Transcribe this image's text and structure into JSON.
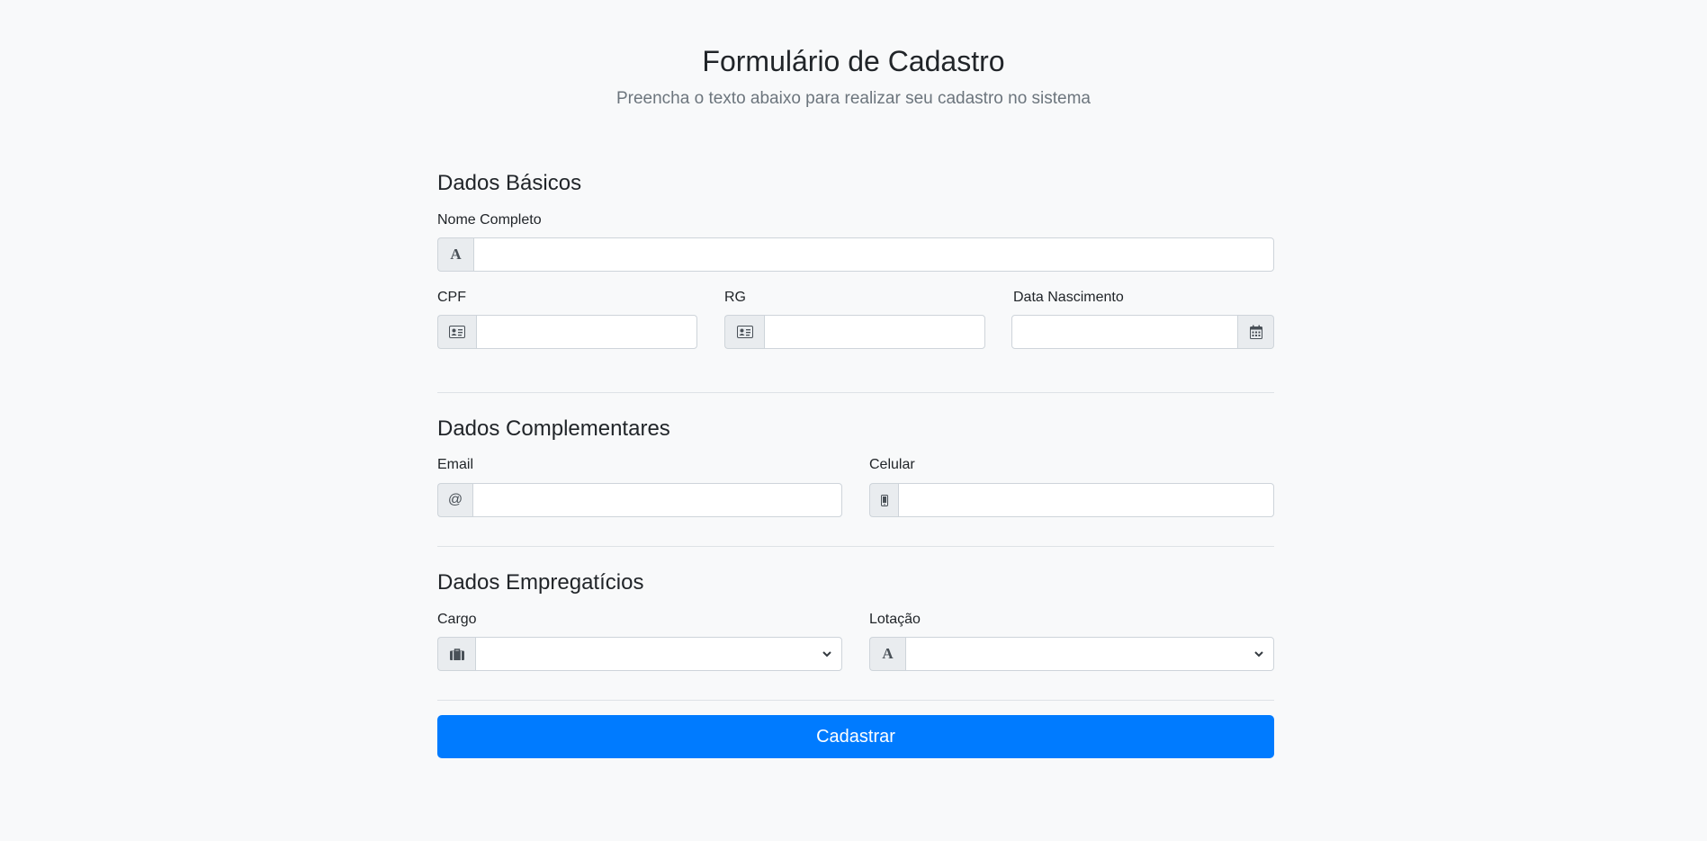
{
  "header": {
    "title": "Formulário de Cadastro",
    "subtitle": "Preencha o texto abaixo para realizar seu cadastro no sistema"
  },
  "sections": {
    "basic": {
      "title": "Dados Básicos",
      "nome": {
        "label": "Nome Completo",
        "value": "",
        "icon": "font-icon"
      },
      "cpf": {
        "label": "CPF",
        "value": "",
        "icon": "id-card-icon"
      },
      "rg": {
        "label": "RG",
        "value": "",
        "icon": "id-card-icon"
      },
      "nascimento": {
        "label": "Data Nascimento",
        "value": "",
        "icon": "calendar-icon"
      }
    },
    "complementary": {
      "title": "Dados Complementares",
      "email": {
        "label": "Email",
        "value": "",
        "icon": "at-icon"
      },
      "celular": {
        "label": "Celular",
        "value": "",
        "icon": "mobile-icon"
      }
    },
    "employment": {
      "title": "Dados Empregatícios",
      "cargo": {
        "label": "Cargo",
        "selected": "",
        "icon": "briefcase-icon"
      },
      "lotacao": {
        "label": "Lotação",
        "selected": "",
        "icon": "font-icon"
      }
    }
  },
  "submit": {
    "label": "Cadastrar"
  },
  "colors": {
    "primary": "#007bff",
    "background": "#f8f9fa",
    "addon": "#e9ecef",
    "border": "#ced4da"
  }
}
